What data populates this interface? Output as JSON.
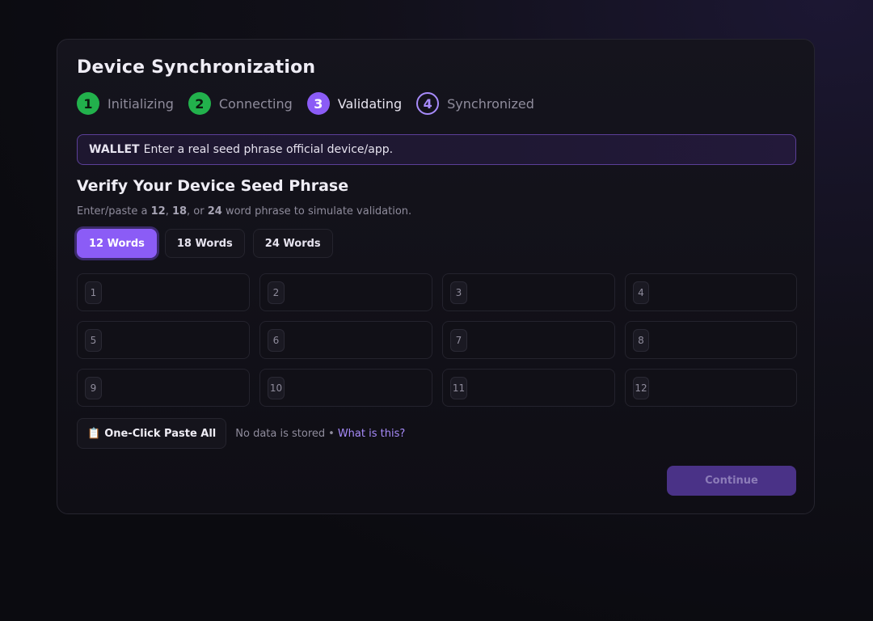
{
  "page": {
    "title": "Device Synchronization",
    "steps": [
      {
        "number": "1",
        "label": "Initializing",
        "state": "done"
      },
      {
        "number": "2",
        "label": "Connecting",
        "state": "done"
      },
      {
        "number": "3",
        "label": "Validating",
        "state": "active"
      },
      {
        "number": "4",
        "label": "Synchronized",
        "state": "pending"
      }
    ],
    "notice": {
      "tag": "WALLET",
      "text": "Enter a real seed phrase official device/app."
    },
    "subtitle": "Verify Your Device Seed Phrase",
    "description": {
      "prefix": "Enter/paste a ",
      "n1": "12",
      "sep1": ", ",
      "n2": "18",
      "sep2": ", or ",
      "n3": "24",
      "suffix": " word phrase to simulate validation."
    },
    "word_count_options": [
      {
        "label": "12 Words",
        "selected": true
      },
      {
        "label": "18 Words",
        "selected": false
      },
      {
        "label": "24 Words",
        "selected": false
      }
    ],
    "word_fields": [
      {
        "number": "1",
        "value": ""
      },
      {
        "number": "2",
        "value": ""
      },
      {
        "number": "3",
        "value": ""
      },
      {
        "number": "4",
        "value": ""
      },
      {
        "number": "5",
        "value": ""
      },
      {
        "number": "6",
        "value": ""
      },
      {
        "number": "7",
        "value": ""
      },
      {
        "number": "8",
        "value": ""
      },
      {
        "number": "9",
        "value": ""
      },
      {
        "number": "10",
        "value": ""
      },
      {
        "number": "11",
        "value": ""
      },
      {
        "number": "12",
        "value": ""
      }
    ],
    "paste_button": {
      "icon": "clipboard-icon",
      "glyph": "📋",
      "label": "One-Click Paste All"
    },
    "note": {
      "text": "No data is stored",
      "separator": "•",
      "link": "What is this?"
    },
    "continue_label": "Continue",
    "colors": {
      "accent": "#8b5cf6",
      "step_done": "#22b14c",
      "link": "#a78bfa",
      "continue_disabled": "#4a3287"
    }
  }
}
